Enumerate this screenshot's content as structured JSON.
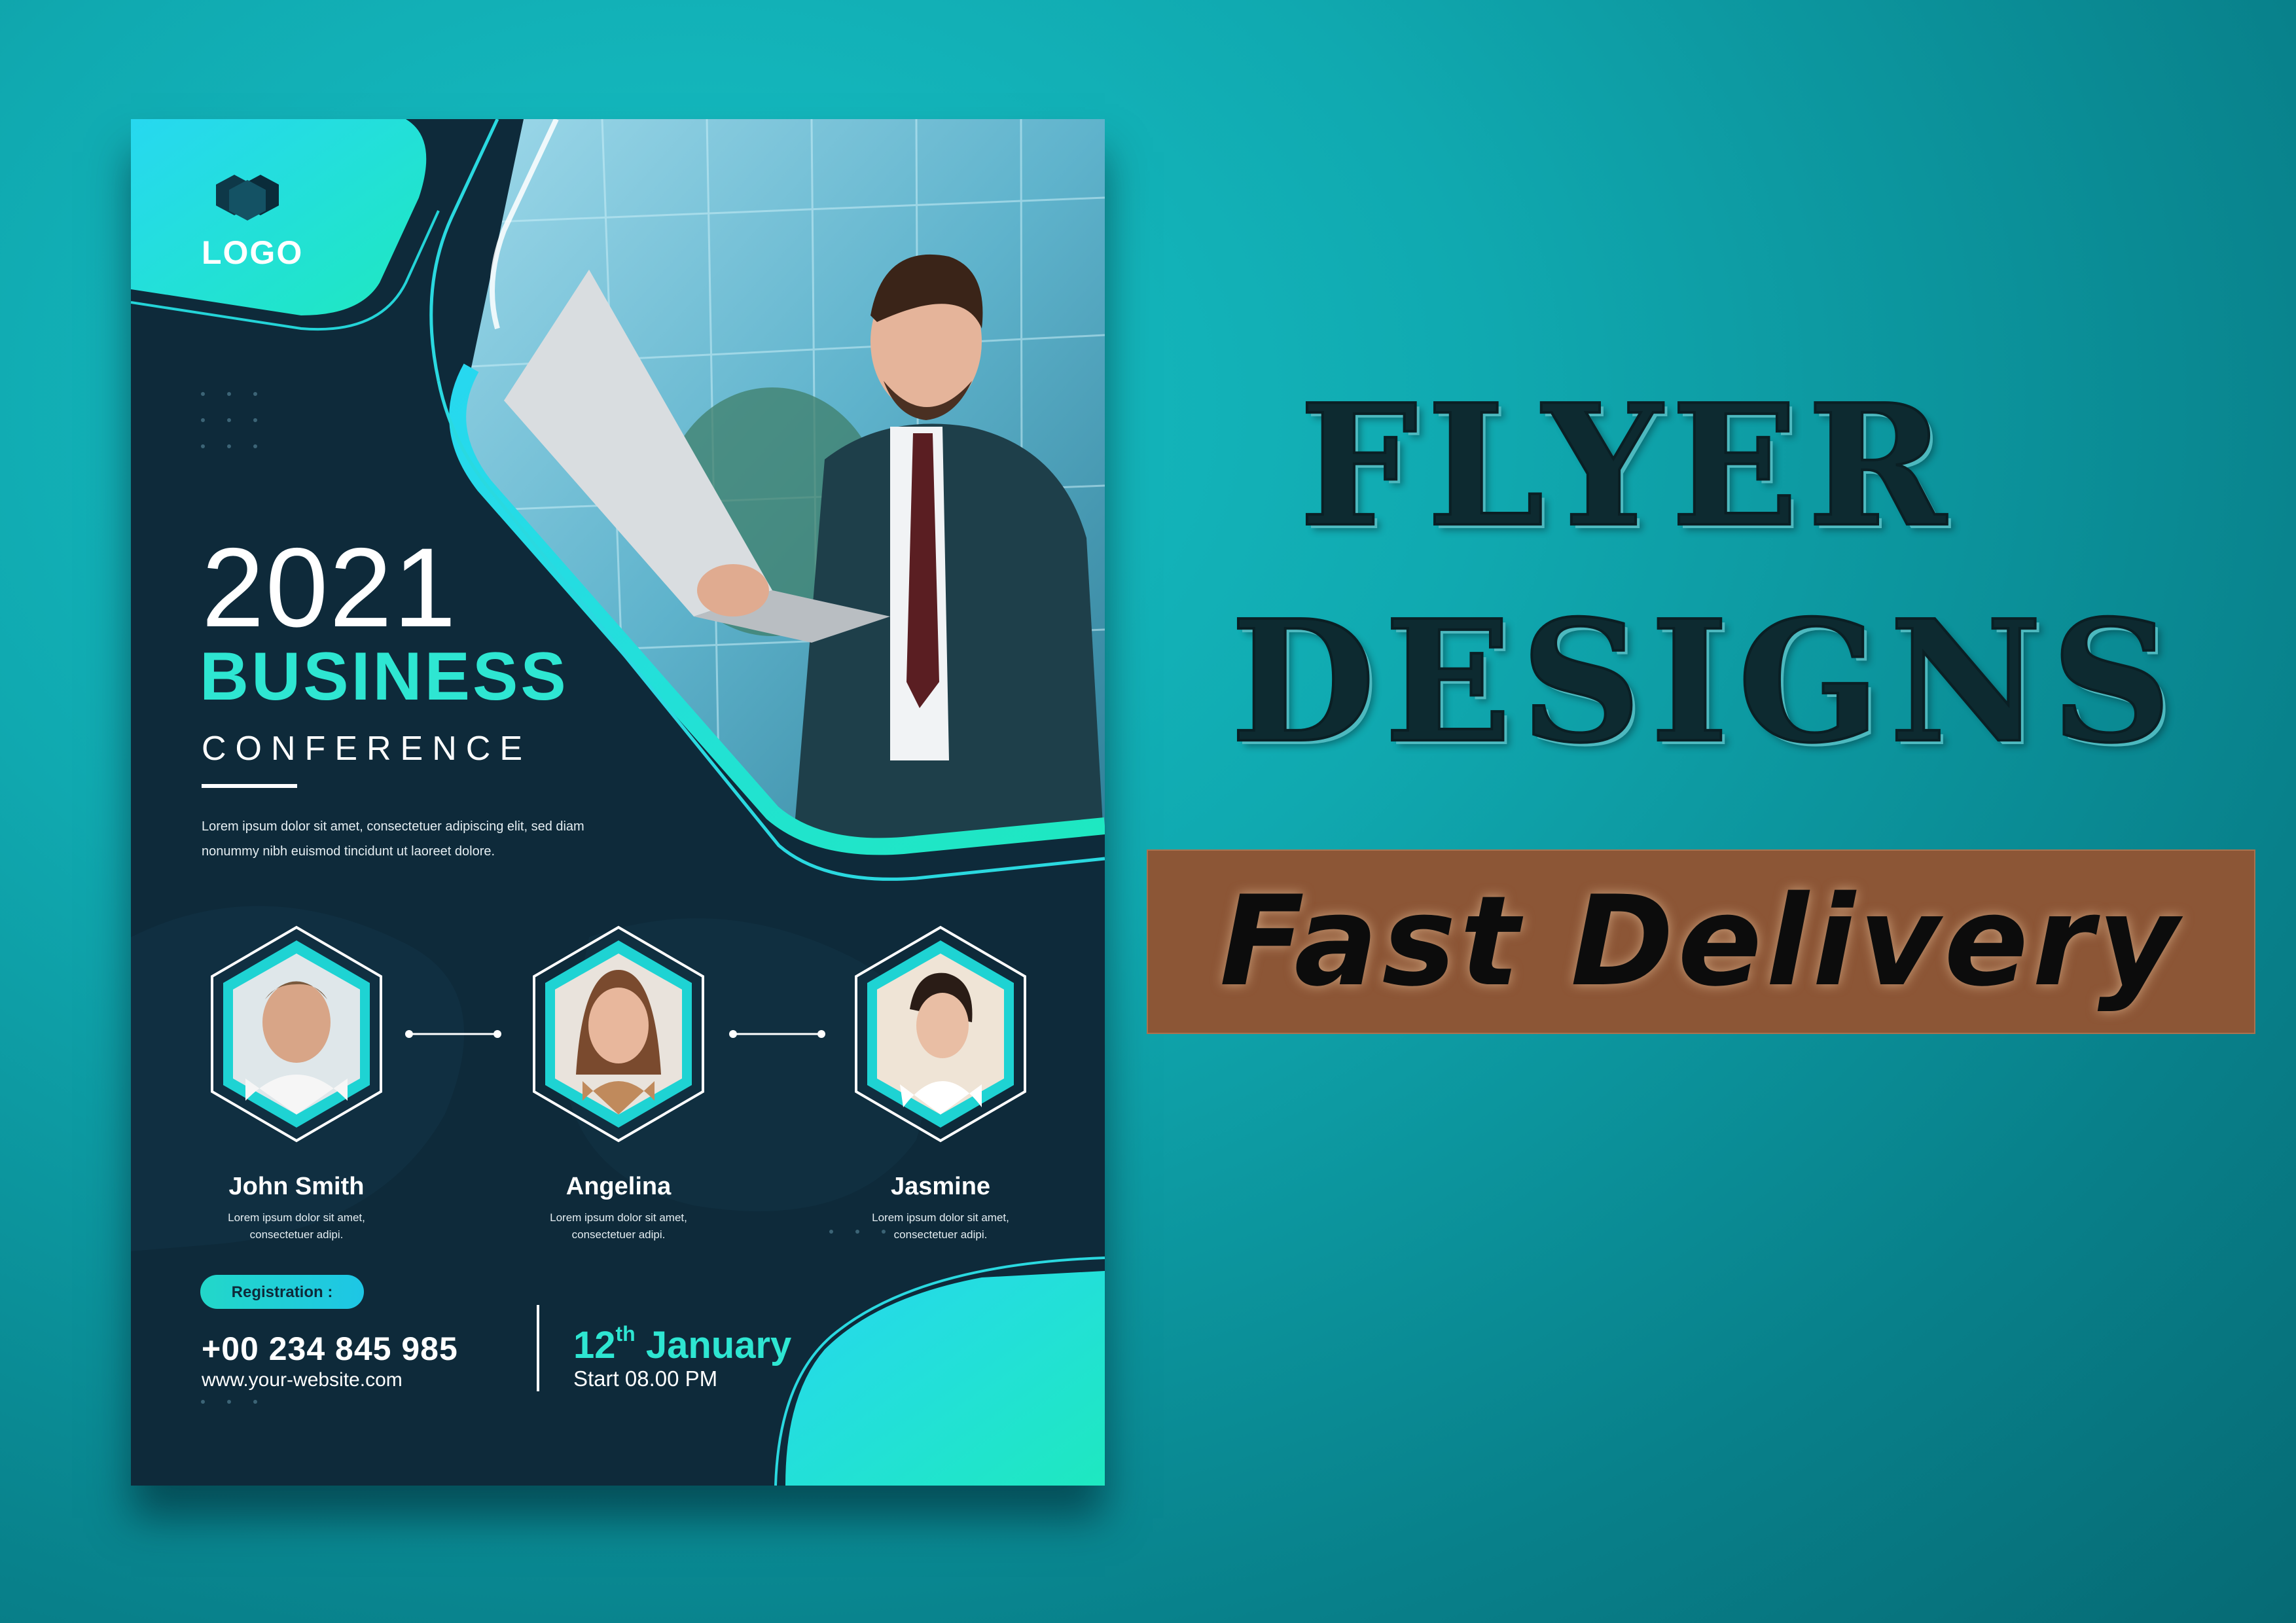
{
  "flyer": {
    "logo_label": "LOGO",
    "year": "2021",
    "headline": "BUSINESS",
    "subheadline": "CONFERENCE",
    "intro_line1": "Lorem ipsum dolor sit amet, consectetuer adipiscing elit, sed diam",
    "intro_line2": "nonummy nibh euismod tincidunt ut laoreet dolore.",
    "speakers": [
      {
        "name": "John Smith",
        "desc_line1": "Lorem ipsum dolor sit amet,",
        "desc_line2": "consectetuer adipi."
      },
      {
        "name": "Angelina",
        "desc_line1": "Lorem ipsum dolor sit amet,",
        "desc_line2": "consectetuer adipi."
      },
      {
        "name": "Jasmine",
        "desc_line1": "Lorem ipsum dolor sit amet,",
        "desc_line2": "consectetuer adipi."
      }
    ],
    "registration_label": "Registration :",
    "phone": "+00 234 845 985",
    "website": "www.your-website.com",
    "date_day": "12",
    "date_suffix": "th",
    "date_month": "January",
    "start_time": "Start 08.00 PM"
  },
  "title": {
    "line1": "FLYER",
    "line2": "DESIGNS"
  },
  "badge": {
    "label": "Fast Delivery"
  },
  "colors": {
    "background": "#10a9b0",
    "flyer_navy": "#0e2a3a",
    "accent_teal": "#2ee6d2",
    "badge_brown": "#8c5636"
  }
}
